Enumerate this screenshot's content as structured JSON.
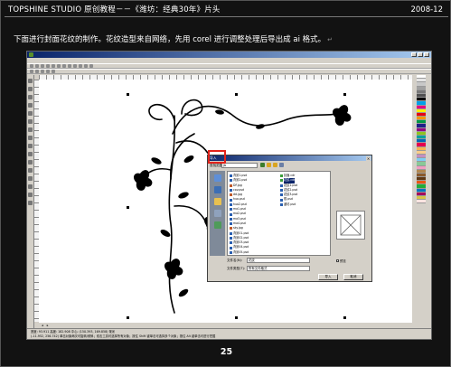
{
  "header": {
    "title": "TOPSHINE STUDIO 原创教程－－《潍坊：经典30年》片头",
    "date": "2008-12"
  },
  "description": "下面进行封面花纹的制作。花纹造型来自网络，先用 corel 进行调整处理后导出成 ai 格式。",
  "return_mark": "↵",
  "page_number": "25",
  "coreldraw": {
    "dialog": {
      "title": "导入",
      "look_in_label": "查找范围(I):",
      "look_in_value": "jb",
      "files_col1": [
        "背景1.psd",
        "背景2.psd",
        "DF.jpg",
        "cov.psd",
        "dd.jpg",
        "hua.psd",
        "hua2.psd",
        "ma1.psd",
        "ma2.psd",
        "ma3.psd",
        "ma4.psd",
        "sky.jpg",
        "背景01.psd",
        "背景02.psd",
        "背景03.psd",
        "背景04.psd",
        "背景05.psd"
      ],
      "files_col2": [
        "封面.cdr",
        "花纹.cdr",
        "花纹1.psd",
        "花纹2.psd",
        "花纹3.psd",
        "框.psd",
        "潍坊.psd"
      ],
      "selected_file": "花纹.cdr",
      "filename_label": "文件名(N):",
      "filename_value": "花纹",
      "filetype_label": "文件类型(T):",
      "filetype_value": "所有文件格式",
      "preview_label": "预览",
      "import_button": "导入",
      "cancel_button": "取消"
    },
    "status_line1": "宽度: 93.911  高度: 182.908  中心: (150.393, 169.858) 毫米",
    "status_line2": "(-11.952, 256.742)  单击对象两次可旋转/倾斜；双击工具可选择所有对象；按住 Shift 键单击可选择多个对象；按住 Alt 键单击可进行挖掘"
  }
}
